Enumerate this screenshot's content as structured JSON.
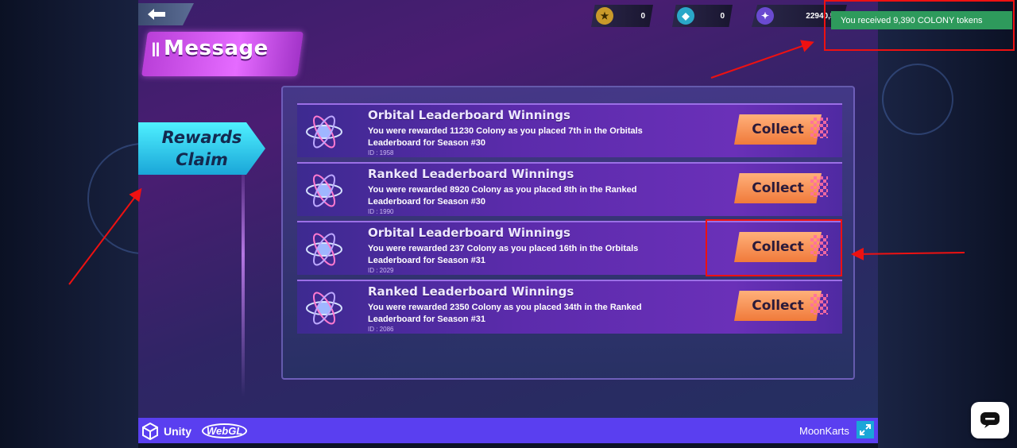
{
  "game": {
    "screen_title": "Message",
    "tab_label_line1": "Rewards",
    "tab_label_line2": "Claim",
    "currencies": [
      {
        "icon": "trophy-icon",
        "value": "0"
      },
      {
        "icon": "diamond-icon",
        "value": "0"
      },
      {
        "icon": "colony-icon",
        "value": "22940,57"
      }
    ]
  },
  "toast": {
    "message": "You received 9,390 COLONY tokens"
  },
  "rewards": [
    {
      "title": "Orbital Leaderboard Winnings",
      "desc": "You were rewarded 11230 Colony as you placed 7th in the Orbitals Leaderboard for Season #30",
      "id": "ID : 1958",
      "button": "Collect"
    },
    {
      "title": "Ranked Leaderboard Winnings",
      "desc": "You were rewarded 8920 Colony as you placed 8th in the Ranked Leaderboard for Season #30",
      "id": "ID : 1990",
      "button": "Collect"
    },
    {
      "title": "Orbital Leaderboard Winnings",
      "desc": "You were rewarded 237 Colony as you placed 16th in the Orbitals Leaderboard for Season #31",
      "id": "ID : 2029",
      "button": "Collect"
    },
    {
      "title": "Ranked Leaderboard Winnings",
      "desc": "You were rewarded 2350 Colony as you placed 34th in the Ranked Leaderboard for Season #31",
      "id": "ID : 2086",
      "button": "Collect"
    }
  ],
  "footer": {
    "engine": "Unity",
    "platform": "WebGL",
    "game_name": "MoonKarts"
  },
  "colors": {
    "accent": "#5a3ff0",
    "toast": "#2e9a5c",
    "collect": "#f07a3a",
    "annotation": "#e11111"
  }
}
